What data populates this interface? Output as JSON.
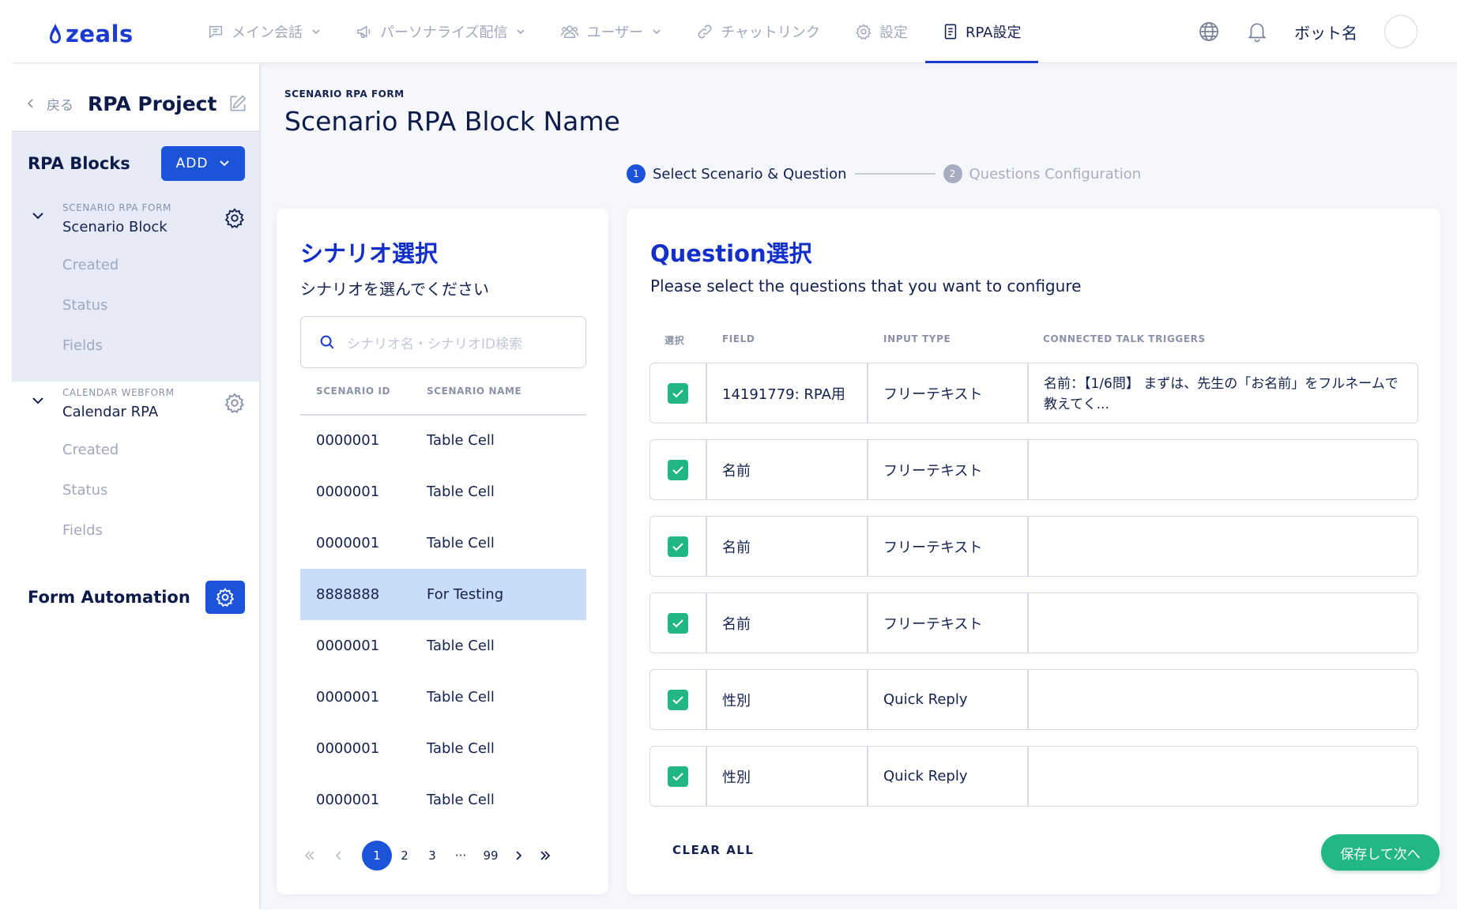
{
  "brand": {
    "logo_text": "zeals",
    "accent": "#1b53d9",
    "success": "#23b787"
  },
  "header": {
    "nav": [
      {
        "label": "メイン会話",
        "icon": "chat-icon",
        "has_dropdown": true,
        "active": false
      },
      {
        "label": "パーソナライズ配信",
        "icon": "megaphone-icon",
        "has_dropdown": true,
        "active": false
      },
      {
        "label": "ユーザー",
        "icon": "users-icon",
        "has_dropdown": true,
        "active": false
      },
      {
        "label": "チャットリンク",
        "icon": "link-icon",
        "has_dropdown": false,
        "active": false
      },
      {
        "label": "設定",
        "icon": "gear-icon",
        "has_dropdown": false,
        "active": false
      },
      {
        "label": "RPA設定",
        "icon": "document-icon",
        "has_dropdown": false,
        "active": true
      }
    ],
    "bot_name": "ボット名"
  },
  "sidebar": {
    "back_label": "戻る",
    "project_title": "RPA Project",
    "blocks_title": "RPA Blocks",
    "add_label": "ADD",
    "blocks": [
      {
        "kind": "SCENARIO RPA FORM",
        "name": "Scenario Block",
        "items": [
          "Created",
          "Status",
          "Fields"
        ]
      },
      {
        "kind": "CALENDAR WEBFORM",
        "name": "Calendar RPA",
        "items": [
          "Created",
          "Status",
          "Fields"
        ]
      }
    ],
    "form_automation": "Form Automation"
  },
  "main": {
    "breadcrumb": "SCENARIO RPA FORM",
    "title": "Scenario RPA Block Name",
    "steps": [
      {
        "number": "1",
        "label": "Select Scenario & Question",
        "active": true
      },
      {
        "number": "2",
        "label": "Questions Configuration",
        "active": false
      }
    ]
  },
  "scenario_panel": {
    "title": "シナリオ選択",
    "subtitle": "シナリオを選んでください",
    "search_placeholder": "シナリオ名・シナリオID検索",
    "columns": {
      "id": "SCENARIO ID",
      "name": "SCENARIO NAME"
    },
    "rows": [
      {
        "id": "0000001",
        "name": "Table Cell",
        "selected": false
      },
      {
        "id": "0000001",
        "name": "Table Cell",
        "selected": false
      },
      {
        "id": "0000001",
        "name": "Table Cell",
        "selected": false
      },
      {
        "id": "8888888",
        "name": "For Testing",
        "selected": true
      },
      {
        "id": "0000001",
        "name": "Table Cell",
        "selected": false
      },
      {
        "id": "0000001",
        "name": "Table Cell",
        "selected": false
      },
      {
        "id": "0000001",
        "name": "Table Cell",
        "selected": false
      },
      {
        "id": "0000001",
        "name": "Table Cell",
        "selected": false
      }
    ],
    "pagination": {
      "pages": [
        "1",
        "2",
        "3"
      ],
      "ellipsis": "···",
      "last": "99",
      "current": "1"
    }
  },
  "question_panel": {
    "title": "Question選択",
    "subtitle": "Please select the questions that you want to configure",
    "columns": {
      "select": "選択",
      "field": "FIELD",
      "input_type": "INPUT TYPE",
      "triggers": "CONNECTED TALK TRIGGERS"
    },
    "rows": [
      {
        "field": "14191779: RPA用",
        "input_type": "フリーテキスト",
        "trigger": "名前：【1/6問】 まずは、先生の「お名前」をフルネームで教えてく...",
        "checked": true
      },
      {
        "field": "名前",
        "input_type": "フリーテキスト",
        "trigger": "",
        "checked": true
      },
      {
        "field": "名前",
        "input_type": "フリーテキスト",
        "trigger": "",
        "checked": true
      },
      {
        "field": "名前",
        "input_type": "フリーテキスト",
        "trigger": "",
        "checked": true
      },
      {
        "field": "性別",
        "input_type": "Quick Reply",
        "trigger": "",
        "checked": true
      },
      {
        "field": "性別",
        "input_type": "Quick Reply",
        "trigger": "",
        "checked": true
      }
    ],
    "clear_all": "CLEAR ALL",
    "save_next": "保存して次へ"
  }
}
